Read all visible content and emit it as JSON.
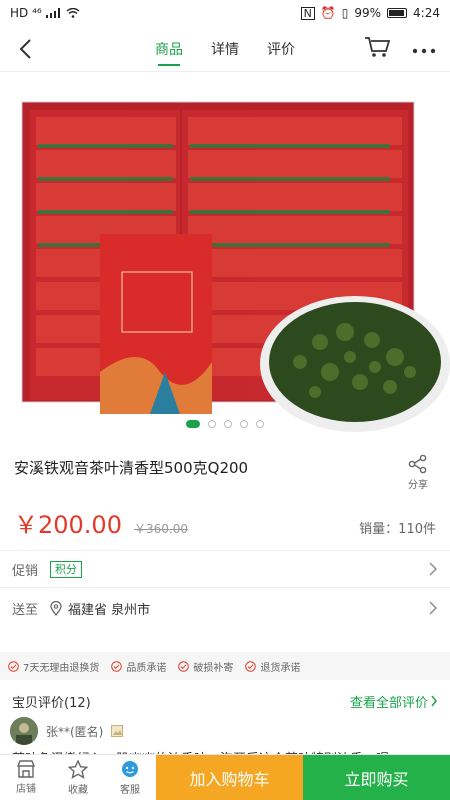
{
  "status": {
    "left": "HD ⁴⁶",
    "battery": "99%",
    "time": "4:24"
  },
  "nav": {
    "tabs": [
      "商品",
      "详情",
      "评价"
    ],
    "active_tab": "商品"
  },
  "gallery": {
    "image_count": 5,
    "current_index": 1
  },
  "product": {
    "title": "安溪铁观音茶叶清香型500克Q200",
    "share_label": "分享",
    "price": "￥200.00",
    "old_price": "￥360.00",
    "sales": "销量：110件"
  },
  "promo": {
    "label": "促销",
    "badge": "积分"
  },
  "delivery": {
    "label": "送至",
    "location": "福建省 泉州市"
  },
  "guarantees": [
    "7天无理由退换货",
    "品质承诺",
    "破损补寄",
    "退货承诺"
  ],
  "reviews": {
    "title": "宝贝评价(12)",
    "view_all": "查看全部评价",
    "reviewer": "张**(匿名)",
    "text": "茶叶色泽嫩绿入一股幽幽的浓香味，泡开后这个茶叶特别浓香，喝"
  },
  "bottom": {
    "shop": "店铺",
    "favorite": "收藏",
    "service": "客服",
    "add_to_cart": "加入购物车",
    "buy_now": "立即购买"
  },
  "colors": {
    "accent": "#1aa34a",
    "price": "#e33a2a",
    "cart_button": "#f5a623",
    "buy_button": "#24b14a"
  }
}
